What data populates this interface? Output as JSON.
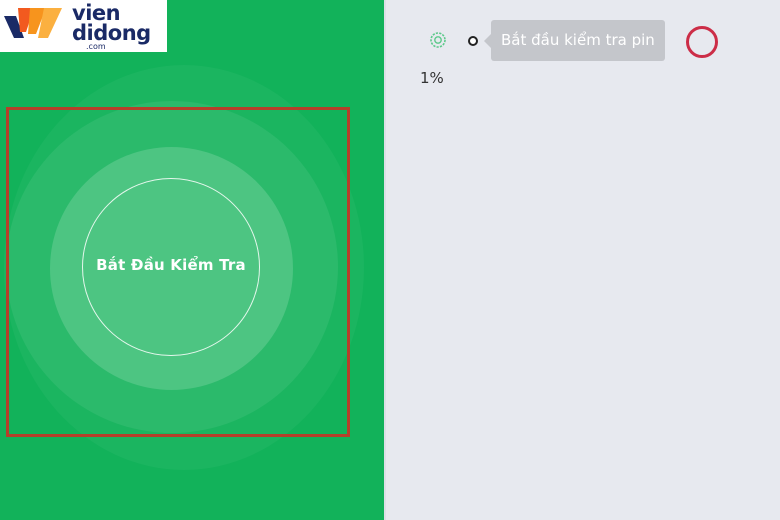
{
  "logo": {
    "line1": "vien",
    "line2": "didong",
    "sub": ".com"
  },
  "test_panel": {
    "start_button_label": "Bắt Đầu Kiểm Tra"
  },
  "toolbar": {
    "tooltip": "Bắt đầu kiểm tra pin",
    "percent": "1%",
    "icons": [
      "gear-icon",
      "dot-indicator",
      "record-button"
    ]
  },
  "colors": {
    "panel_green": "#12b25a",
    "highlight_border": "#b5402a",
    "record_red": "#cc2d47",
    "tooltip_bg": "#c4c6cb",
    "background": "#e7e9ef"
  }
}
